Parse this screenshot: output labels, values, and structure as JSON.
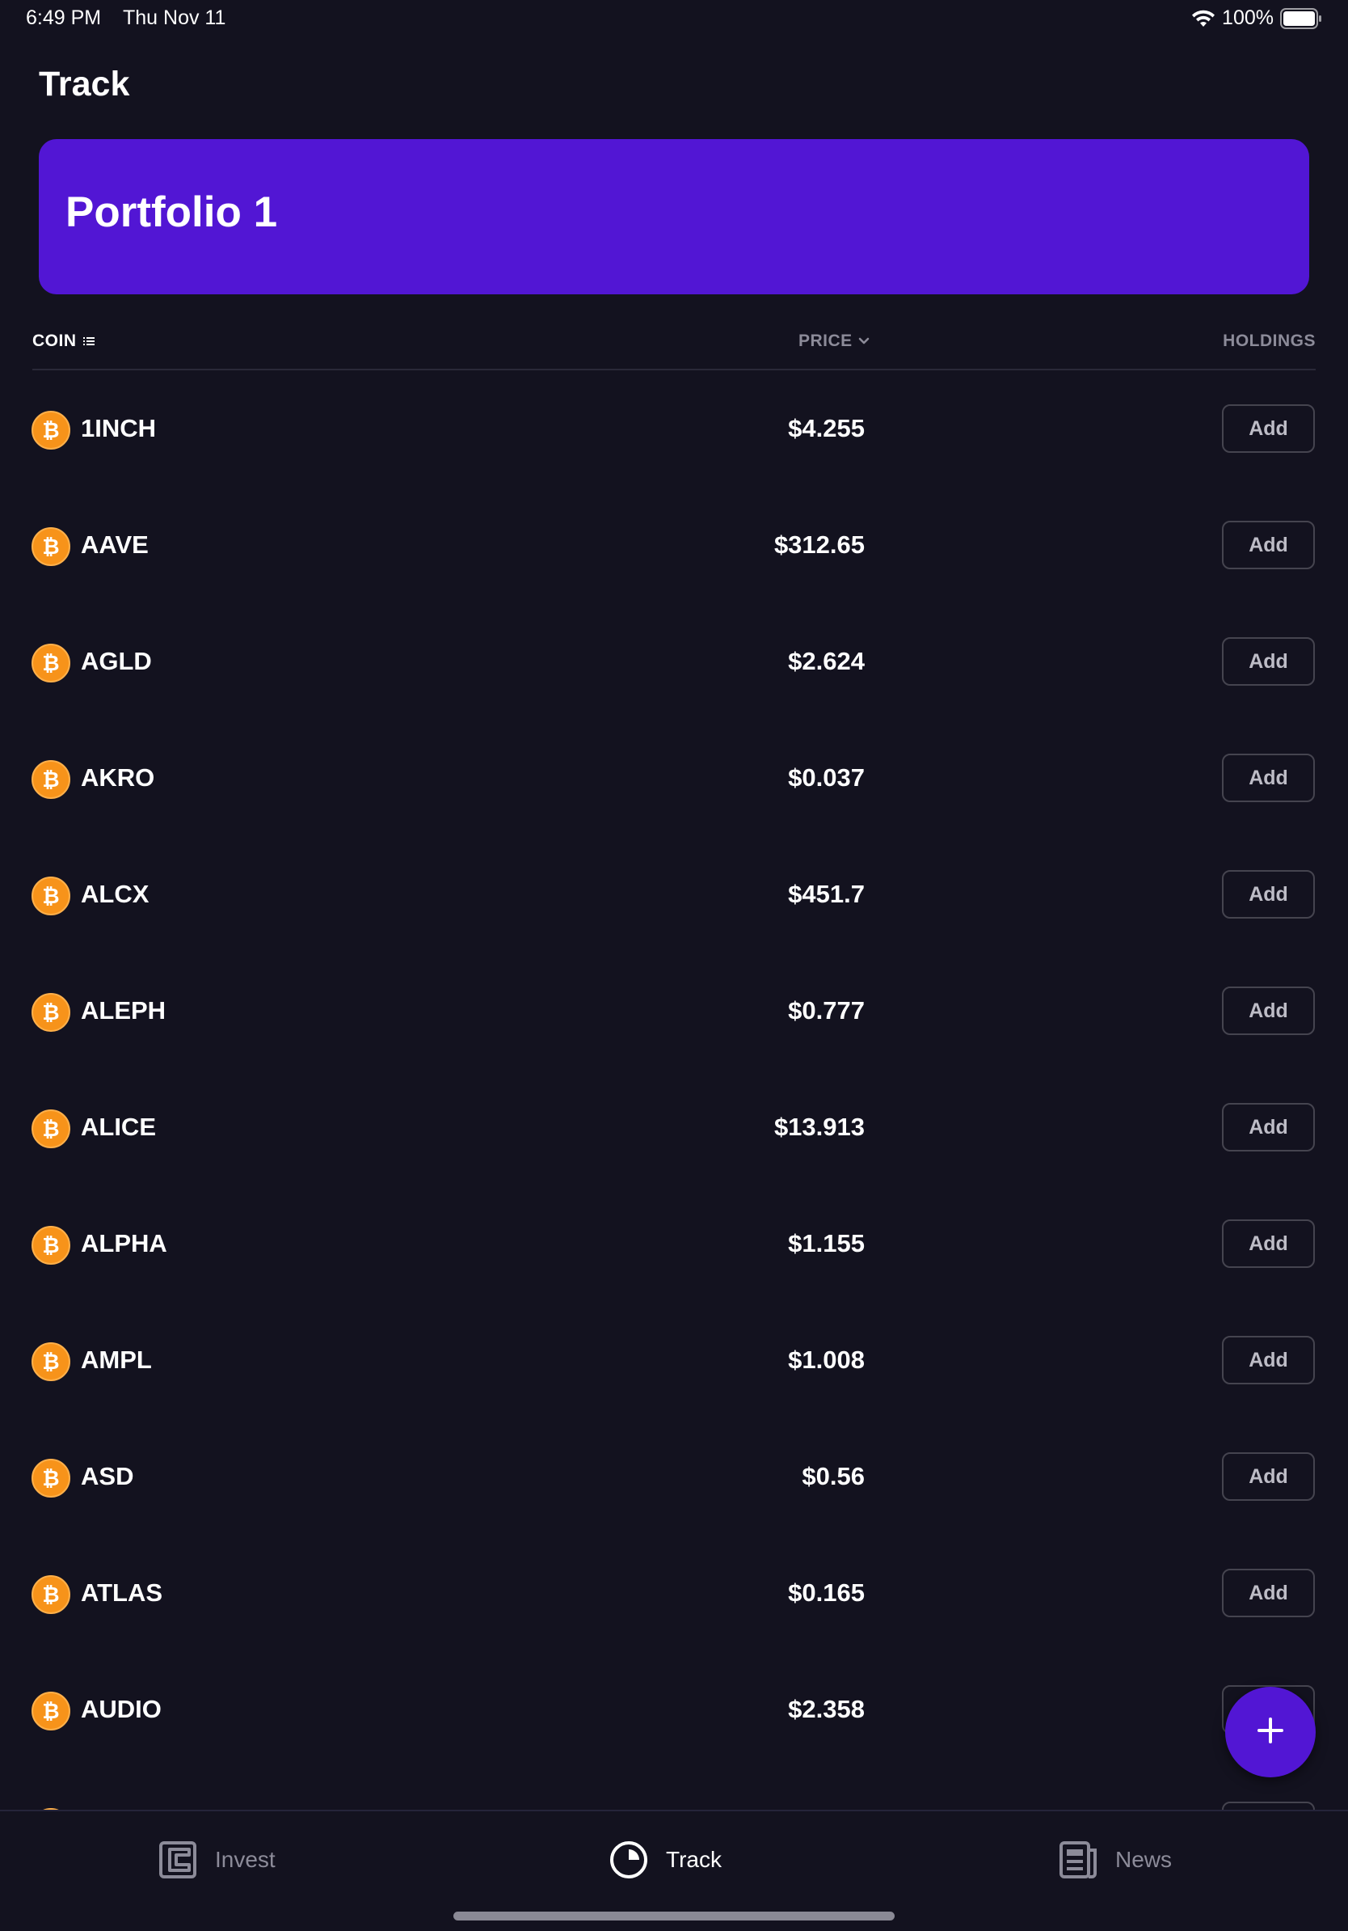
{
  "status_bar": {
    "time": "6:49 PM",
    "date": "Thu Nov 11",
    "battery": "100%"
  },
  "header": {
    "title": "Track"
  },
  "portfolio": {
    "name": "Portfolio 1",
    "color": "#5216d4"
  },
  "table": {
    "col_coin": "COIN",
    "col_price": "PRICE",
    "col_holdings": "HOLDINGS",
    "add_label": "Add",
    "coin_icon": "bitcoin-icon",
    "rows": [
      {
        "symbol": "1INCH",
        "price": "$4.255"
      },
      {
        "symbol": "AAVE",
        "price": "$312.65"
      },
      {
        "symbol": "AGLD",
        "price": "$2.624"
      },
      {
        "symbol": "AKRO",
        "price": "$0.037"
      },
      {
        "symbol": "ALCX",
        "price": "$451.7"
      },
      {
        "symbol": "ALEPH",
        "price": "$0.777"
      },
      {
        "symbol": "ALICE",
        "price": "$13.913"
      },
      {
        "symbol": "ALPHA",
        "price": "$1.155"
      },
      {
        "symbol": "AMPL",
        "price": "$1.008"
      },
      {
        "symbol": "ASD",
        "price": "$0.56"
      },
      {
        "symbol": "ATLAS",
        "price": "$0.165"
      },
      {
        "symbol": "AUDIO",
        "price": "$2.358"
      }
    ]
  },
  "fab": {
    "icon": "plus-icon"
  },
  "bottom_nav": {
    "items": [
      {
        "label": "Invest",
        "icon": "wallet-icon",
        "active": false
      },
      {
        "label": "Track",
        "icon": "pie-chart-icon",
        "active": true
      },
      {
        "label": "News",
        "icon": "newspaper-icon",
        "active": false
      }
    ]
  }
}
